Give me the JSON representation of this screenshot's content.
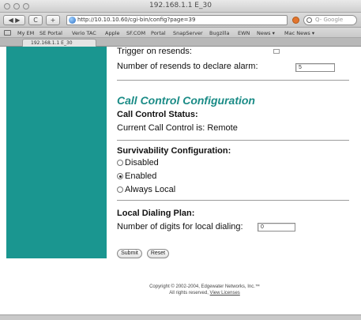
{
  "window": {
    "title": "192.168.1.1 E_30"
  },
  "toolbar": {
    "url": "http://10.10.10.60/cgi-bin/config?page=39",
    "search_placeholder": "Q- Google",
    "reload_label": "C",
    "add_label": "+"
  },
  "bookmarks": [
    "My EM",
    "SE Portal",
    "Verio TAC",
    "Apple",
    "SF.COM",
    "Portal",
    "SnapServer",
    "Bugzilla",
    "EWN",
    "News ▾",
    "Mac News ▾"
  ],
  "tab": {
    "title": "192.168.1.1 E_30"
  },
  "alarm": {
    "trigger_label": "Trigger on resends:",
    "resends_label": "Number of resends to declare alarm:",
    "resends_value": "5"
  },
  "call_control": {
    "section_title": "Call Control Configuration",
    "status_heading": "Call Control Status:",
    "status_text": "Current Call Control is: Remote"
  },
  "survivability": {
    "heading": "Survivability Configuration:",
    "options": [
      {
        "label": "Disabled",
        "selected": false
      },
      {
        "label": "Enabled",
        "selected": true
      },
      {
        "label": "Always Local",
        "selected": false
      }
    ]
  },
  "dialing": {
    "heading": "Local Dialing Plan:",
    "digits_label": "Number of digits for local dialing:",
    "digits_value": "0"
  },
  "buttons": {
    "submit": "Submit",
    "reset": "Reset"
  },
  "footer": {
    "line1": "Copyright © 2002-2004, Edgewater Networks, Inc.™",
    "line2_prefix": "All rights reserved,",
    "license_link": "View Licenses"
  },
  "colors": {
    "sidebar": "#1a9690",
    "section_title": "#1a8b86"
  }
}
